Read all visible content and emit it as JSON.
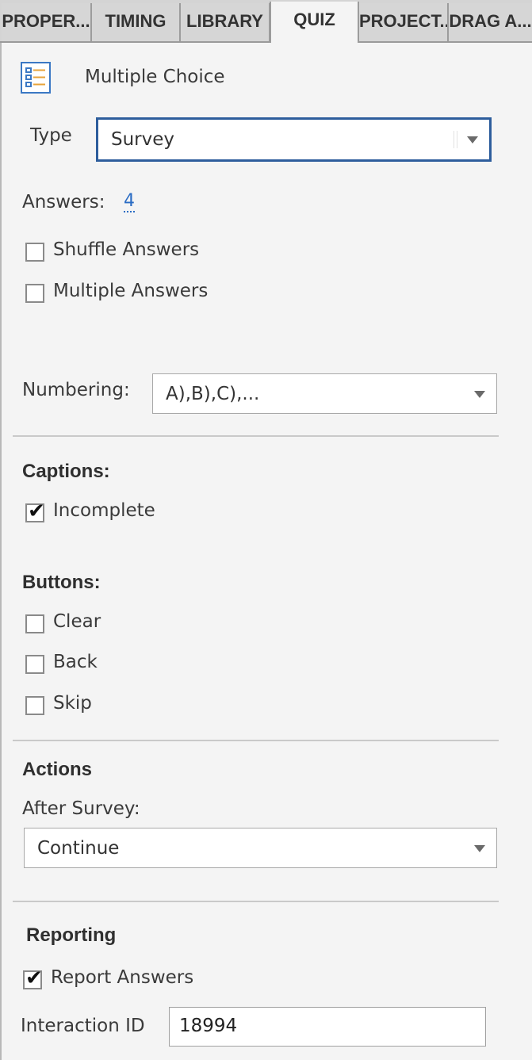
{
  "tabs": [
    "PROPER...",
    "TIMING",
    "LIBRARY",
    "QUIZ",
    "PROJECT...",
    "DRAG A..."
  ],
  "active_tab": "QUIZ",
  "header": {
    "icon": "multiple-choice-icon",
    "title": "Multiple Choice"
  },
  "type": {
    "label": "Type",
    "value": "Survey"
  },
  "answers": {
    "label": "Answers:",
    "value": "4"
  },
  "options": {
    "shuffle": {
      "label": "Shuffle Answers",
      "checked": false
    },
    "multiple": {
      "label": "Multiple Answers",
      "checked": false
    }
  },
  "numbering": {
    "label": "Numbering:",
    "value": "A),B),C),..."
  },
  "captions": {
    "heading": "Captions:",
    "incomplete": {
      "label": "Incomplete",
      "checked": true
    }
  },
  "buttons": {
    "heading": "Buttons:",
    "clear": {
      "label": "Clear",
      "checked": false
    },
    "back": {
      "label": "Back",
      "checked": false
    },
    "skip": {
      "label": "Skip",
      "checked": false
    }
  },
  "actions": {
    "heading": "Actions",
    "after_label": "After Survey:",
    "after_value": "Continue"
  },
  "reporting": {
    "heading": "Reporting",
    "report_answers": {
      "label": "Report Answers",
      "checked": true
    },
    "interaction_label": "Interaction ID",
    "interaction_value": "18994"
  },
  "colors": {
    "accent": "#2d5d9c",
    "link": "#2a6cc4",
    "panel": "#f4f4f4",
    "tab_bar": "#d4d4d4"
  }
}
